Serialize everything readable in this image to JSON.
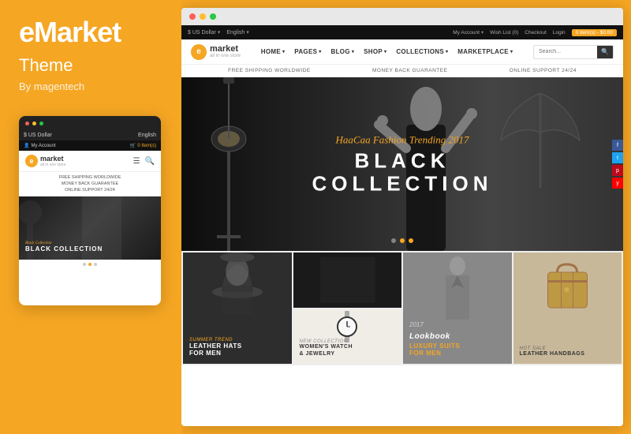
{
  "left": {
    "brand": "eMarket",
    "theme_label": "Theme",
    "by_label": "By magentech",
    "mobile": {
      "dots": [
        "red",
        "yellow",
        "green"
      ],
      "currency": "$ US Dollar",
      "language": "English",
      "account": "My Account",
      "cart": "0 Item(s)",
      "logo_letter": "e",
      "logo_name": "market",
      "logo_sub": "all in one store",
      "benefits": [
        "FREE SHIPPING WORLDWIDE",
        "MONEY BACK GUARANTEE",
        "ONLINE SUPPORT 24/24"
      ],
      "hero_text": "BLACK COLLECTION",
      "dots_state": [
        "active",
        "",
        ""
      ]
    }
  },
  "right": {
    "browser_dots": [
      "red",
      "yellow",
      "green"
    ],
    "store": {
      "topbar": {
        "currency": "$ US Dollar",
        "language": "English",
        "account": "My Account",
        "wishlist": "Wish List (0)",
        "checkout": "Checkout",
        "login": "Login",
        "cart_label": "0 item(s) - $0.00"
      },
      "logo_letter": "e",
      "logo_name": "market",
      "logo_sub": "all in one store",
      "nav_items": [
        "HOME",
        "PAGES",
        "BLOG",
        "SHOP",
        "COLLECTIONS",
        "MARKETPLACE"
      ],
      "search_placeholder": "Search...",
      "benefits": [
        "FREE SHIPPING WORLDWIDE",
        "MONEY BACK GUARANTEE",
        "ONLINE SUPPORT 24/24"
      ],
      "hero": {
        "script": "HaaCaa Fashion Trending 2017",
        "title": "BLACK COLLECTION",
        "dots": [
          "",
          "active",
          ""
        ]
      },
      "side_btns": [
        "f",
        "t",
        "p",
        "y"
      ],
      "grid": [
        {
          "id": "hats",
          "sublabel": "Summer Trend",
          "title": "LEATHER HATS\nFOR MEN",
          "span": "tall"
        },
        {
          "id": "summer",
          "sublabel": "",
          "title": ""
        },
        {
          "id": "watches",
          "sublabel": "New Collection",
          "title": "WOMEN'S WATCH\n& JEWELRY"
        },
        {
          "id": "lookbook",
          "year": "2017",
          "sublabel": "Lookbook",
          "title": "LUXURY SUITS\nFOR MEN",
          "span": "tall"
        },
        {
          "id": "handbags",
          "sublabel": "Hot Sale",
          "title": "LEATHER HANDBAGS",
          "span": "tall"
        }
      ]
    }
  }
}
